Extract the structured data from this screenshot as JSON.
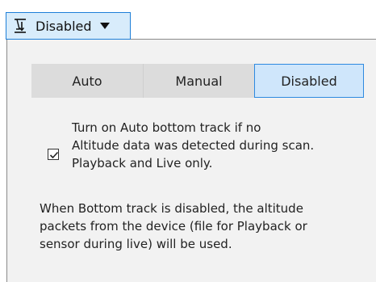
{
  "dropdown": {
    "icon": "bottom-track-icon",
    "label": "Disabled"
  },
  "mode_selector": {
    "options": [
      "Auto",
      "Manual",
      "Disabled"
    ],
    "selected": "Disabled",
    "accent": "#2d8ae0"
  },
  "auto_track_option": {
    "checked": true,
    "text_line1": "Turn on Auto bottom track if no",
    "text_line2": "Altitude data was detected during scan.",
    "text_line3": "Playback and Live only."
  },
  "note": {
    "line1": "When Bottom track is disabled, the altitude",
    "line2": "packets from the device (file for Playback or",
    "line3": "sensor during live) will be used."
  }
}
